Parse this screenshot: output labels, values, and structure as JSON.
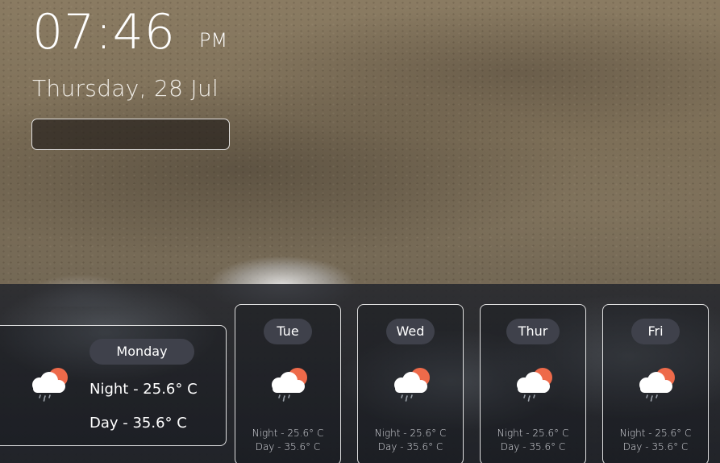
{
  "clock": {
    "time": "07:46",
    "period": "PM"
  },
  "date": "Thursday, 28 Jul",
  "search": {
    "value": "",
    "placeholder": ""
  },
  "today": {
    "day": "Monday",
    "icon": "cloud-sun-rain-icon",
    "night": "Night - 25.6° C",
    "day_temp": "Day - 35.6° C"
  },
  "forecast": [
    {
      "day": "Tue",
      "icon": "cloud-sun-rain-icon",
      "night": "Night - 25.6° C",
      "day_temp": "Day - 35.6° C"
    },
    {
      "day": "Wed",
      "icon": "cloud-sun-rain-icon",
      "night": "Night - 25.6° C",
      "day_temp": "Day - 35.6° C"
    },
    {
      "day": "Thur",
      "icon": "cloud-sun-rain-icon",
      "night": "Night - 25.6° C",
      "day_temp": "Day - 35.6° C"
    },
    {
      "day": "Fri",
      "icon": "cloud-sun-rain-icon",
      "night": "Night - 25.6° C",
      "day_temp": "Day - 35.6° C"
    }
  ],
  "colors": {
    "sun": "#ee6a4a",
    "pill": "#3f414b",
    "band": "#26282e"
  }
}
